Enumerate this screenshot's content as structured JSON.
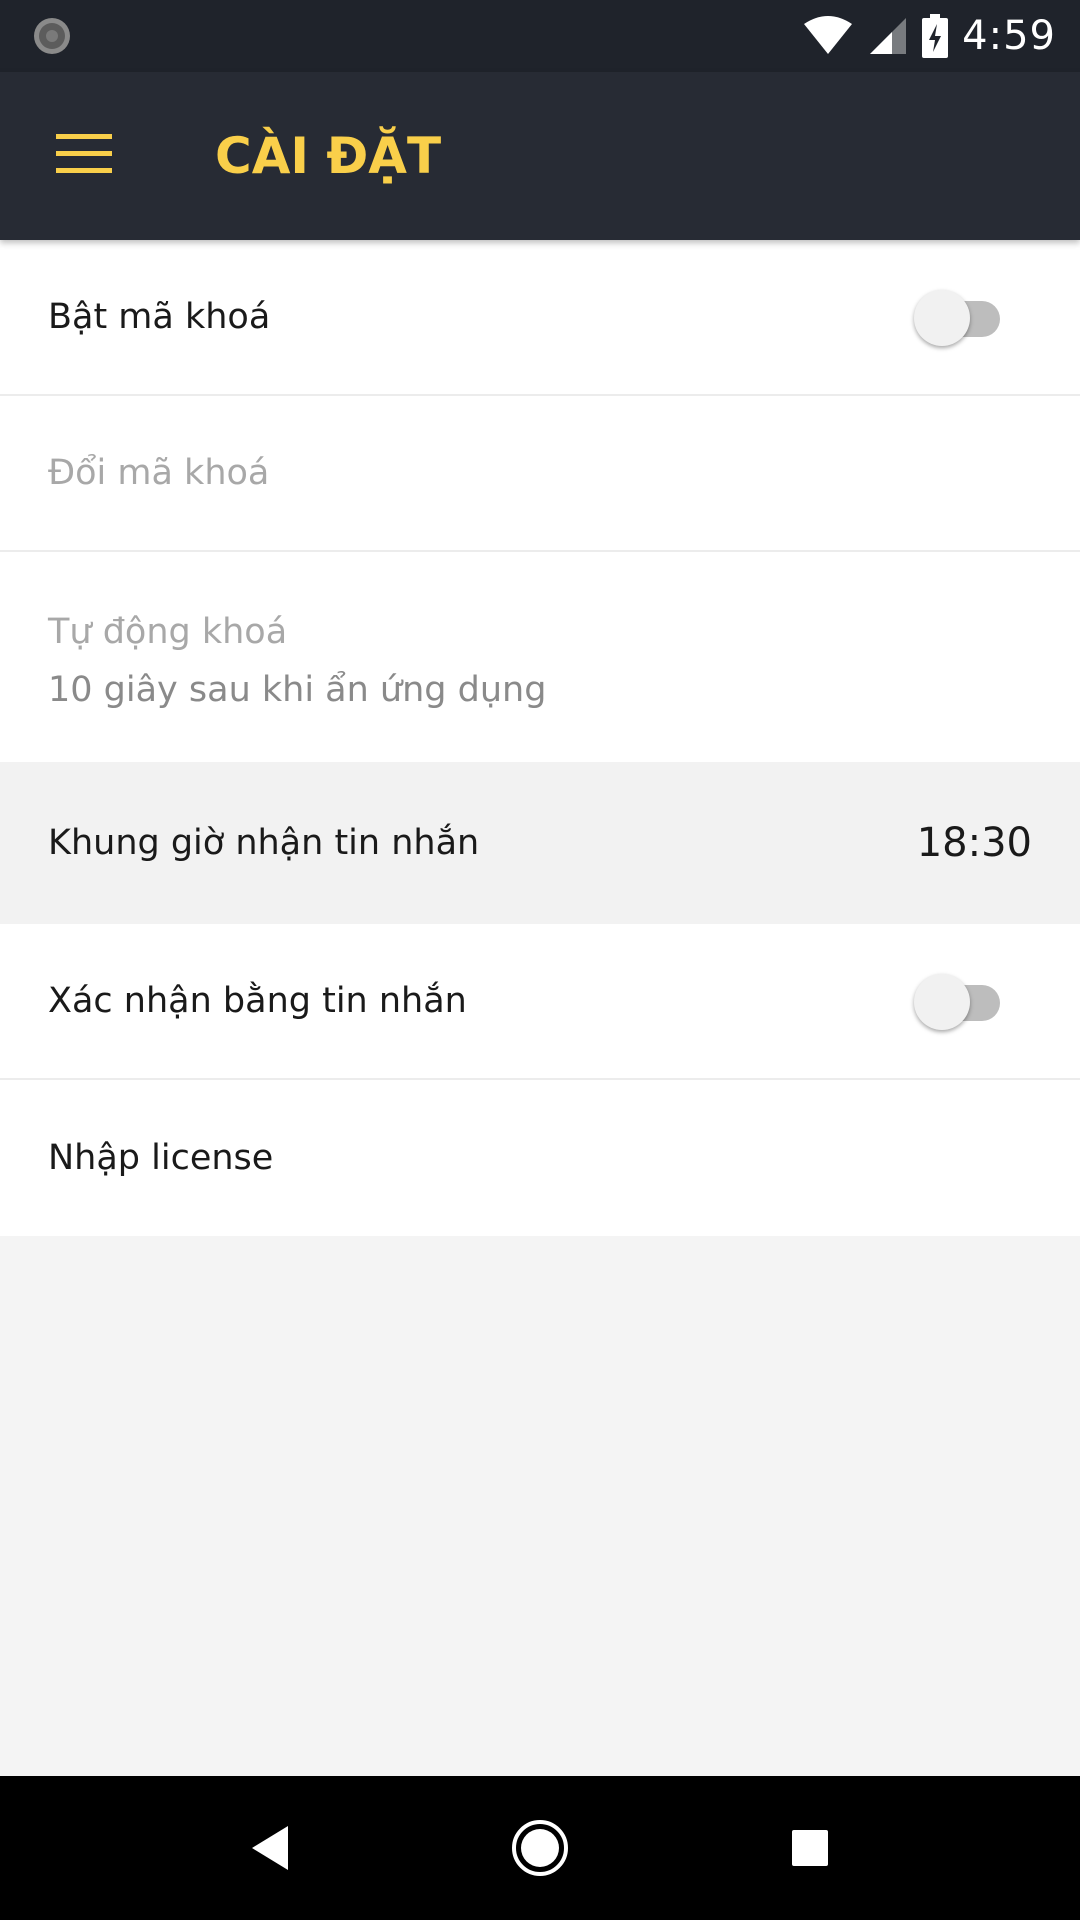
{
  "status_bar": {
    "time": "4:59",
    "icons": [
      "loading-spinner-icon",
      "wifi-icon",
      "cell-signal-icon",
      "battery-charging-icon"
    ]
  },
  "app_bar": {
    "title": "CÀI ĐẶT",
    "accent_color": "#f9cf4a",
    "menu_icon": "hamburger-menu-icon"
  },
  "settings": {
    "enable_passcode": {
      "label": "Bật mã khoá",
      "on": false
    },
    "change_passcode": {
      "label": "Đổi mã khoá"
    },
    "auto_lock": {
      "label": "Tự động khoá",
      "value": "10 giây sau khi ẩn ứng dụng"
    },
    "message_time": {
      "label": "Khung giờ nhận tin nhắn",
      "value": "18:30"
    },
    "sms_confirm": {
      "label": "Xác nhận bằng tin nhắn",
      "on": false
    },
    "license": {
      "label": "Nhập license"
    }
  },
  "nav_bar": {
    "icons": [
      "back-icon",
      "home-icon",
      "recents-icon"
    ]
  }
}
